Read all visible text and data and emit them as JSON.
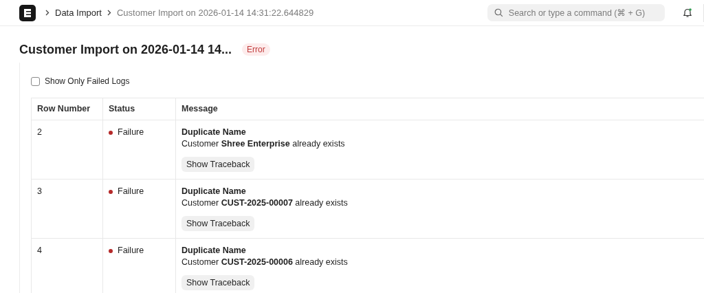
{
  "breadcrumbs": [
    {
      "label": "Data Import",
      "current": false
    },
    {
      "label": "Customer Import on 2026-01-14 14:31:22.644829",
      "current": true
    }
  ],
  "search": {
    "placeholder": "Search or type a command (⌘ + G)"
  },
  "notifications": {
    "unread": true
  },
  "page": {
    "title": "Customer Import on 2026-01-14 14...",
    "status": "Error"
  },
  "filter": {
    "label": "Show Only Failed Logs",
    "checked": false
  },
  "table": {
    "columns": [
      "Row Number",
      "Status",
      "Message"
    ],
    "rows": [
      {
        "row_number": "2",
        "status": "Failure",
        "kind": "failure",
        "title": "Duplicate Name",
        "message": "Customer **Shree Enterprise** already exists",
        "action": "Show Traceback"
      },
      {
        "row_number": "3",
        "status": "Failure",
        "kind": "failure",
        "title": "Duplicate Name",
        "message": "Customer **CUST-2025-00007** already exists",
        "action": "Show Traceback"
      },
      {
        "row_number": "4",
        "status": "Failure",
        "kind": "failure",
        "title": "Duplicate Name",
        "message": "Customer **CUST-2025-00006** already exists",
        "action": "Show Traceback"
      }
    ]
  }
}
